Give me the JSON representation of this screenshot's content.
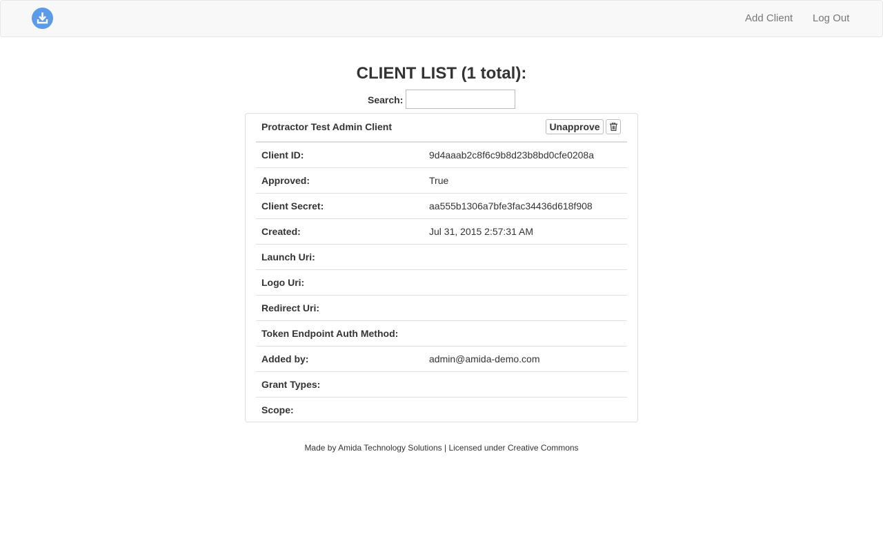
{
  "navbar": {
    "logo_icon": "download-icon",
    "add_client": "Add Client",
    "log_out": "Log Out"
  },
  "page": {
    "title": "CLIENT LIST (1 total):",
    "search_label": "Search:",
    "search_value": ""
  },
  "client": {
    "name": "Protractor Test Admin Client",
    "unapprove_label": "Unapprove",
    "delete_icon": "trash-icon",
    "fields": [
      {
        "label": "Client ID:",
        "value": "9d4aaab2c8f6c9b8d23b8bd0cfe0208a"
      },
      {
        "label": "Approved:",
        "value": "True"
      },
      {
        "label": "Client Secret:",
        "value": "aa555b1306a7bfe3fac34436d618f908"
      },
      {
        "label": "Created:",
        "value": "Jul 31, 2015 2:57:31 AM"
      },
      {
        "label": "Launch Uri:",
        "value": ""
      },
      {
        "label": "Logo Uri:",
        "value": ""
      },
      {
        "label": "Redirect Uri:",
        "value": ""
      },
      {
        "label": "Token Endpoint Auth Method:",
        "value": ""
      },
      {
        "label": "Added by:",
        "value": "admin@amida-demo.com"
      },
      {
        "label": "Grant Types:",
        "value": ""
      },
      {
        "label": "Scope:",
        "value": ""
      }
    ]
  },
  "footer": {
    "text": "Made by Amida Technology Solutions | Licensed under Creative Commons"
  },
  "colors": {
    "logo": "#5b9bea",
    "navbar_bg": "#f8f8f8",
    "border": "#dddddd",
    "nav_link": "#777777"
  }
}
